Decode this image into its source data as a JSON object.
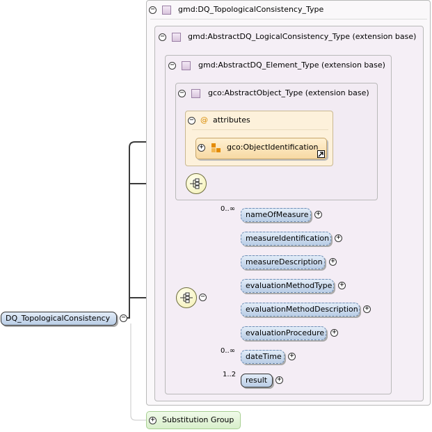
{
  "boxes": {
    "topological_type": "gmd:DQ_TopologicalConsistency_Type",
    "logical_type": "gmd:AbstractDQ_LogicalConsistency_Type (extension base)",
    "element_type": "gmd:AbstractDQ_Element_Type (extension base)",
    "object_type": "gco:AbstractObject_Type (extension base)"
  },
  "attributes": {
    "header": "attributes",
    "at_symbol": "@",
    "object_identification": "gco:ObjectIdentification"
  },
  "root_element": "DQ_TopologicalConsistency",
  "substitution_group": "Substitution Group",
  "elements": [
    {
      "label": "nameOfMeasure",
      "cardinality": "0..∞"
    },
    {
      "label": "measureIdentification",
      "cardinality": ""
    },
    {
      "label": "measureDescription",
      "cardinality": ""
    },
    {
      "label": "evaluationMethodType",
      "cardinality": ""
    },
    {
      "label": "evaluationMethodDescription",
      "cardinality": ""
    },
    {
      "label": "evaluationProcedure",
      "cardinality": ""
    },
    {
      "label": "dateTime",
      "cardinality": "0..∞"
    },
    {
      "label": "result",
      "cardinality": "1..2"
    }
  ],
  "colors": {
    "type_box_bg": "#f4eef5",
    "attributes_bg": "#fdf1db",
    "element_fill": "#c9daef",
    "substitution_bg": "#e6f5dc"
  },
  "icons": {
    "collapse": "minus-circle-icon",
    "expand": "plus-circle-icon",
    "type": "complex-type-square-icon",
    "sequence": "sequence-compositor-icon",
    "attribute_group": "attribute-group-icon",
    "reference": "reference-arrow-icon"
  },
  "symbols": {
    "minus": "−",
    "plus": "+"
  }
}
